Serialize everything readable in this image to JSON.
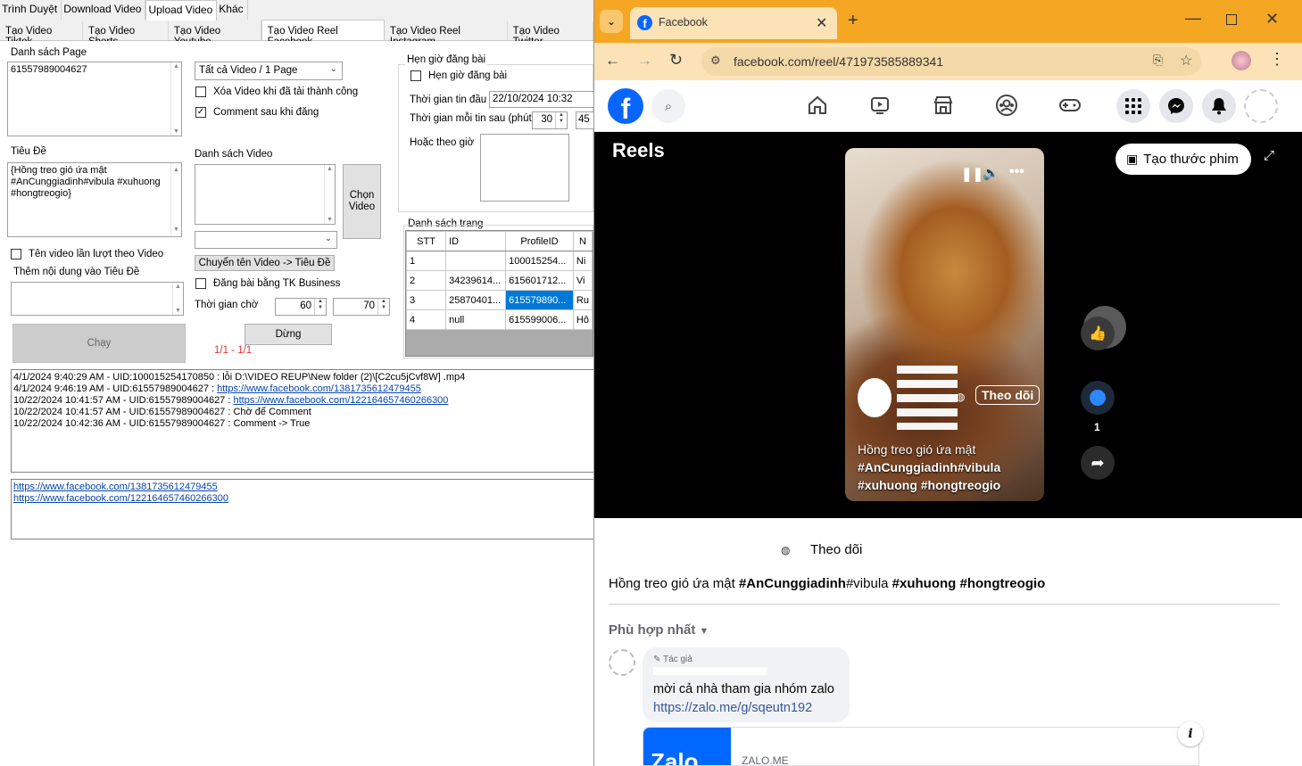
{
  "app": {
    "menu": [
      "Trình Duyệt",
      "Download Video",
      "Upload Video",
      "Khác"
    ],
    "subtabs": [
      "Tạo Video Tiktok",
      "Tạo Video Shorts",
      "Tạo Video Youtube",
      "Tạo Video Reel Facebook",
      "Tạo Video Reel Instagram",
      "Tạo Video Twitter"
    ],
    "page_list_label": "Danh sách Page",
    "page_list_value": "61557989004627",
    "title_label": "Tiêu Đề",
    "title_value": "{Hồng treo gió ứa mật #AnCunggiadinh#vibula #xuhuong #hongtreogio}",
    "video_select": "Tất cả Video / 1 Page",
    "chk_delete": "Xóa Video khi đã tải thành công",
    "chk_comment": "Comment sau khi đăng",
    "video_list_label": "Danh sách Video",
    "choose_video_btn": "Chọn Video",
    "rename_btn": "Chuyển tên Video -> Tiêu Đề",
    "chk_business": "Đăng bài bằng TK Business",
    "wait_label": "Thời gian chờ",
    "wait_min": "60",
    "wait_max": "70",
    "stop_btn": "Dừng",
    "progress": "1/1 - 1/1",
    "chk_name_video": "Tên video lần lượt theo Video",
    "add_title_label": "Thêm nội dung vào Tiêu Đề",
    "run_btn": "Chạy",
    "schedule_group": "Hẹn giờ đăng bài",
    "chk_schedule": "Hẹn giờ đăng bài",
    "first_time_label": "Thời gian tin đầu",
    "first_time_value": "22/10/2024 10:32",
    "interval_label": "Thời gian mỗi tin sau (phút)",
    "interval_value": "30",
    "interval_value2": "45",
    "or_time_label": "Hoặc theo giờ",
    "page_table_label": "Danh sách trang",
    "grid_headers": [
      "STT",
      "ID",
      "ProfileID",
      "N"
    ],
    "grid_rows": [
      [
        "1",
        "",
        "100015254...",
        "Ni"
      ],
      [
        "2",
        "34239614...",
        "615601712...",
        "Vi"
      ],
      [
        "3",
        "25870401...",
        "615579890...",
        "Ru"
      ],
      [
        "4",
        "null",
        "615599006...",
        "Hô"
      ]
    ],
    "log_lines": [
      {
        "text": "4/1/2024 9:40:29 AM - UID:100015254170850 : lỗi  D:\\VIDEO REUP\\New folder (2)\\[C2cu5jCvf8W] .mp4",
        "link": ""
      },
      {
        "text": "4/1/2024 9:46:19 AM - UID:61557989004627 : ",
        "link": "https://www.facebook.com/1381735612479455"
      },
      {
        "text": "10/22/2024 10:41:57 AM - UID:61557989004627 : ",
        "link": "https://www.facebook.com/122164657460266300"
      },
      {
        "text": "10/22/2024 10:41:57 AM - UID:61557989004627 : Chờ để Comment",
        "link": ""
      },
      {
        "text": "10/22/2024 10:42:36 AM - UID:61557989004627 : Comment -> True",
        "link": ""
      }
    ],
    "links": [
      "https://www.facebook.com/1381735612479455",
      "https://www.facebook.com/122164657460266300"
    ]
  },
  "browser": {
    "tab_title": "Facebook",
    "url": "facebook.com/reel/471973585889341",
    "reels_title": "Reels",
    "create_btn": "Tạo thước phim",
    "follow_label": "Theo dõi",
    "video_caption_lines": [
      "Hồng treo gió ứa mật",
      "#AnCunggiadinh#vibula",
      "#xuhuong #hongtreogio"
    ],
    "comment_count": "1",
    "follow_below": "Theo dõi",
    "description_plain": "Hồng treo gió ứa mật ",
    "description_tag1": "#AnCunggiadinh",
    "description_plain2": "#vibula ",
    "description_tag2": "#xuhuong #hongtreogio",
    "sort_label": "Phù hợp nhất",
    "author_badge": "Tác giả",
    "comment_text": "mời cả nhà tham gia nhóm zalo",
    "comment_link": "https://zalo.me/g/sqeutn192",
    "preview_domain": "ZALO.ME",
    "preview_logo": "Zalo",
    "colors": {
      "titlebar": "#f5a623",
      "fb_blue": "#0866ff"
    }
  }
}
